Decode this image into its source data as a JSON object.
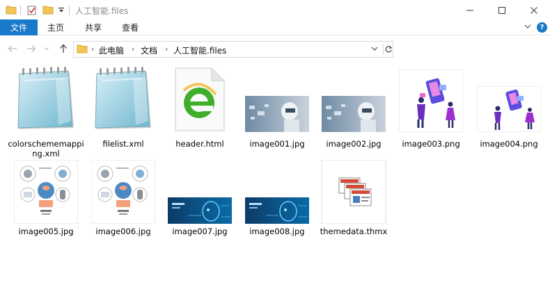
{
  "window": {
    "title": "人工智能.files"
  },
  "ribbon": {
    "file_tab": "文件",
    "tabs": [
      "主页",
      "共享",
      "查看"
    ],
    "help_label": "?"
  },
  "address": {
    "crumbs": [
      "此电脑",
      "文档",
      "人工智能.files"
    ]
  },
  "files": [
    {
      "name": "colorschememapping.xml",
      "icon": "notepad-icon"
    },
    {
      "name": "filelist.xml",
      "icon": "notepad-icon"
    },
    {
      "name": "header.html",
      "icon": "ie-html-icon"
    },
    {
      "name": "image001.jpg",
      "icon": "robot-photo-thumbnail"
    },
    {
      "name": "image002.jpg",
      "icon": "robot-photo-thumbnail"
    },
    {
      "name": "image003.png",
      "icon": "people-screens-thumbnail"
    },
    {
      "name": "image004.png",
      "icon": "people-screens-thumbnail"
    },
    {
      "name": "image005.jpg",
      "icon": "ai-brain-diagram-thumbnail"
    },
    {
      "name": "image006.jpg",
      "icon": "ai-brain-diagram-thumbnail"
    },
    {
      "name": "image007.jpg",
      "icon": "tech-head-banner-thumbnail"
    },
    {
      "name": "image008.jpg",
      "icon": "tech-head-banner-thumbnail"
    },
    {
      "name": "themedata.thmx",
      "icon": "theme-file-icon"
    }
  ],
  "colors": {
    "accent": "#1979ca",
    "folder": "#f3c556"
  }
}
